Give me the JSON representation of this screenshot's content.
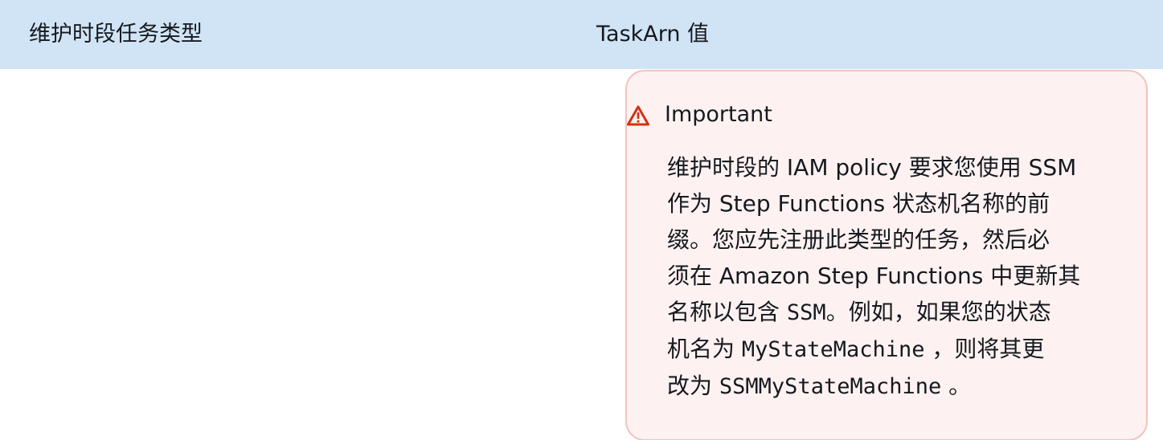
{
  "table": {
    "headers": [
      "维护时段任务类型",
      "TaskArn 值"
    ]
  },
  "alert": {
    "icon": "warning-icon",
    "title": "Important",
    "lines": [
      {
        "text": "维护时段的 IAM policy 要求您使用 SSM"
      },
      {
        "text": "作为 Step Functions 状态机名称的前"
      },
      {
        "text": "缀。您应先注册此类型的任务，然后必"
      },
      {
        "text": "须在 Amazon Step Functions 中更新其"
      },
      {
        "pre": "名称以包含 ",
        "code": "SSM",
        "post": "。例如，如果您的状态"
      },
      {
        "pre": "机名为 ",
        "code": "MyStateMachine",
        "post": " ，则将其更"
      },
      {
        "pre": "改为 ",
        "code": "SSMMyStateMachine",
        "post": " 。"
      }
    ]
  },
  "colors": {
    "header_bg": "#d1e4f6",
    "alert_bg": "#fdf2f1",
    "alert_border": "#f2c4c0",
    "warning_icon": "#d13212"
  }
}
